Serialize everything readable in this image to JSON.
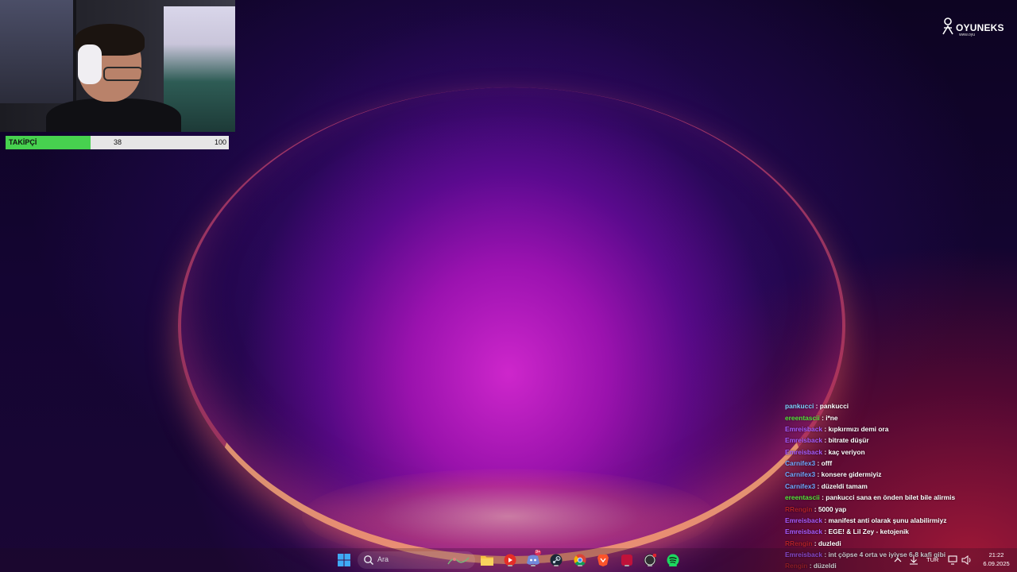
{
  "overlay": {
    "follower_bar": {
      "label": "TAKİPÇİ",
      "current": "38",
      "goal": "100",
      "progress": 0.38,
      "fill_color": "#47d14f"
    },
    "logo": {
      "name": "OYUNEKS",
      "sub": "www.oyu"
    }
  },
  "chat": {
    "messages": [
      {
        "user": "",
        "text": "",
        "color": "#9b59ff",
        "faded": true
      },
      {
        "user": "pankucci",
        "text": "pankucci",
        "color": "#7fd0ff",
        "faded": false
      },
      {
        "user": "ereentascii",
        "text": "i*ne",
        "color": "#55e23c",
        "faded": false
      },
      {
        "user": "Emreisback",
        "text": "kıpkırmızı demi ora",
        "color": "#a65bff",
        "faded": false
      },
      {
        "user": "Emreisback",
        "text": "bitrate düşür",
        "color": "#a65bff",
        "faded": false
      },
      {
        "user": "Emreisback",
        "text": "kaç veriyon",
        "color": "#a65bff",
        "faded": false
      },
      {
        "user": "Carnifex3",
        "text": "offf",
        "color": "#6fa8ff",
        "faded": false
      },
      {
        "user": "Carnifex3",
        "text": "konsere gidermiyiz",
        "color": "#6fa8ff",
        "faded": false
      },
      {
        "user": "Carnifex3",
        "text": "düzeldi tamam",
        "color": "#6fa8ff",
        "faded": false
      },
      {
        "user": "ereentascii",
        "text": "pankucci sana en önden bilet bile alirmis",
        "color": "#55e23c",
        "faded": false
      },
      {
        "user": "RRengin",
        "text": "5000 yap",
        "color": "#b0202a",
        "faded": false
      },
      {
        "user": "Emreisback",
        "text": "manifest anti olarak şunu alabilirmiyz",
        "color": "#a65bff",
        "faded": false
      },
      {
        "user": "Emreisback",
        "text": "EGE! & Lil Zey - ketojenik",
        "color": "#a65bff",
        "faded": false
      },
      {
        "user": "RRengin",
        "text": "duzledi",
        "color": "#b0202a",
        "faded": false
      },
      {
        "user": "Emreisback",
        "text": "int çöpse 4 orta ve iyiyse 6-8 kafi gibi",
        "color": "#a65bff",
        "faded": false
      },
      {
        "user": "Rengin",
        "text": "düzeldi",
        "color": "#b0202a",
        "faded": false
      }
    ]
  },
  "taskbar": {
    "search_placeholder": "Ara",
    "apps": [
      {
        "name": "start-icon"
      },
      {
        "name": "file-explorer-icon"
      },
      {
        "name": "youtube-icon"
      },
      {
        "name": "discord-icon",
        "badge": "9+"
      },
      {
        "name": "steam-icon"
      },
      {
        "name": "chrome-icon"
      },
      {
        "name": "brave-icon"
      },
      {
        "name": "app-red-icon"
      },
      {
        "name": "obs-icon"
      },
      {
        "name": "spotify-icon"
      }
    ],
    "tray": {
      "language": "TUR",
      "time": "21:22",
      "date": "6.09.2025"
    }
  }
}
